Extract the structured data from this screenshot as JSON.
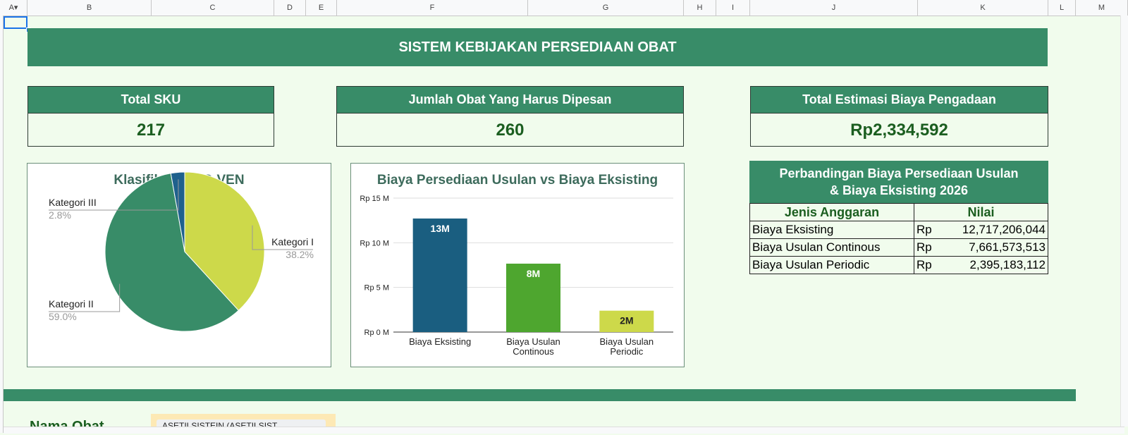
{
  "columns": [
    "A",
    "B",
    "C",
    "D",
    "E",
    "F",
    "G",
    "H",
    "I",
    "J",
    "K",
    "L",
    "M"
  ],
  "banner_title": "SISTEM KEBIJAKAN PERSEDIAAN OBAT",
  "kpis": [
    {
      "label": "Total SKU",
      "value": "217"
    },
    {
      "label": "Jumlah Obat Yang Harus Dipesan",
      "value": "260"
    },
    {
      "label": "Total Estimasi Biaya Pengadaan",
      "value": "Rp2,334,592"
    }
  ],
  "pie_chart": {
    "title": "Klasifikasi ABC-VEN",
    "slices": [
      {
        "label": "Kategori I",
        "pct_text": "38.2%",
        "value": 38.2,
        "color": "#cdd94a"
      },
      {
        "label": "Kategori II",
        "pct_text": "59.0%",
        "value": 59.0,
        "color": "#388c68"
      },
      {
        "label": "Kategori III",
        "pct_text": "2.8%",
        "value": 2.8,
        "color": "#1f618d"
      }
    ]
  },
  "chart_data": {
    "type": "bar",
    "title": "Biaya Persediaan Usulan vs Biaya Eksisting",
    "categories": [
      "Biaya Eksisting",
      "Biaya Usulan Continous",
      "Biaya Usulan Periodic"
    ],
    "category_lines": [
      [
        "Biaya Eksisting"
      ],
      [
        "Biaya Usulan",
        "Continous"
      ],
      [
        "Biaya Usulan",
        "Periodic"
      ]
    ],
    "values": [
      12717206044,
      7661573513,
      2395183112
    ],
    "data_labels": [
      "13M",
      "8M",
      "2M"
    ],
    "colors": [
      "#1a5e80",
      "#4ea62f",
      "#cdd94a"
    ],
    "yticks": [
      "Rp 0 M",
      "Rp 5 M",
      "Rp 10 M",
      "Rp 15 M"
    ],
    "ylim": [
      0,
      15000000000
    ],
    "grid": true
  },
  "comparison": {
    "title_line1": "Perbandingan Biaya Persediaan Usulan",
    "title_line2": "& Biaya Eksisting 2026",
    "headers": [
      "Jenis Anggaran",
      "Nilai"
    ],
    "rows": [
      {
        "name": "Biaya Eksisting",
        "cur": "Rp",
        "amount": "12,717,206,044"
      },
      {
        "name": "Biaya Usulan Continous",
        "cur": "Rp",
        "amount": "7,661,573,513"
      },
      {
        "name": "Biaya Usulan Periodic",
        "cur": "Rp",
        "amount": "2,395,183,112"
      }
    ]
  },
  "nama_obat_label": "Nama Obat",
  "nama_obat_value": "ASETILSISTEIN (ASETILSIST..."
}
